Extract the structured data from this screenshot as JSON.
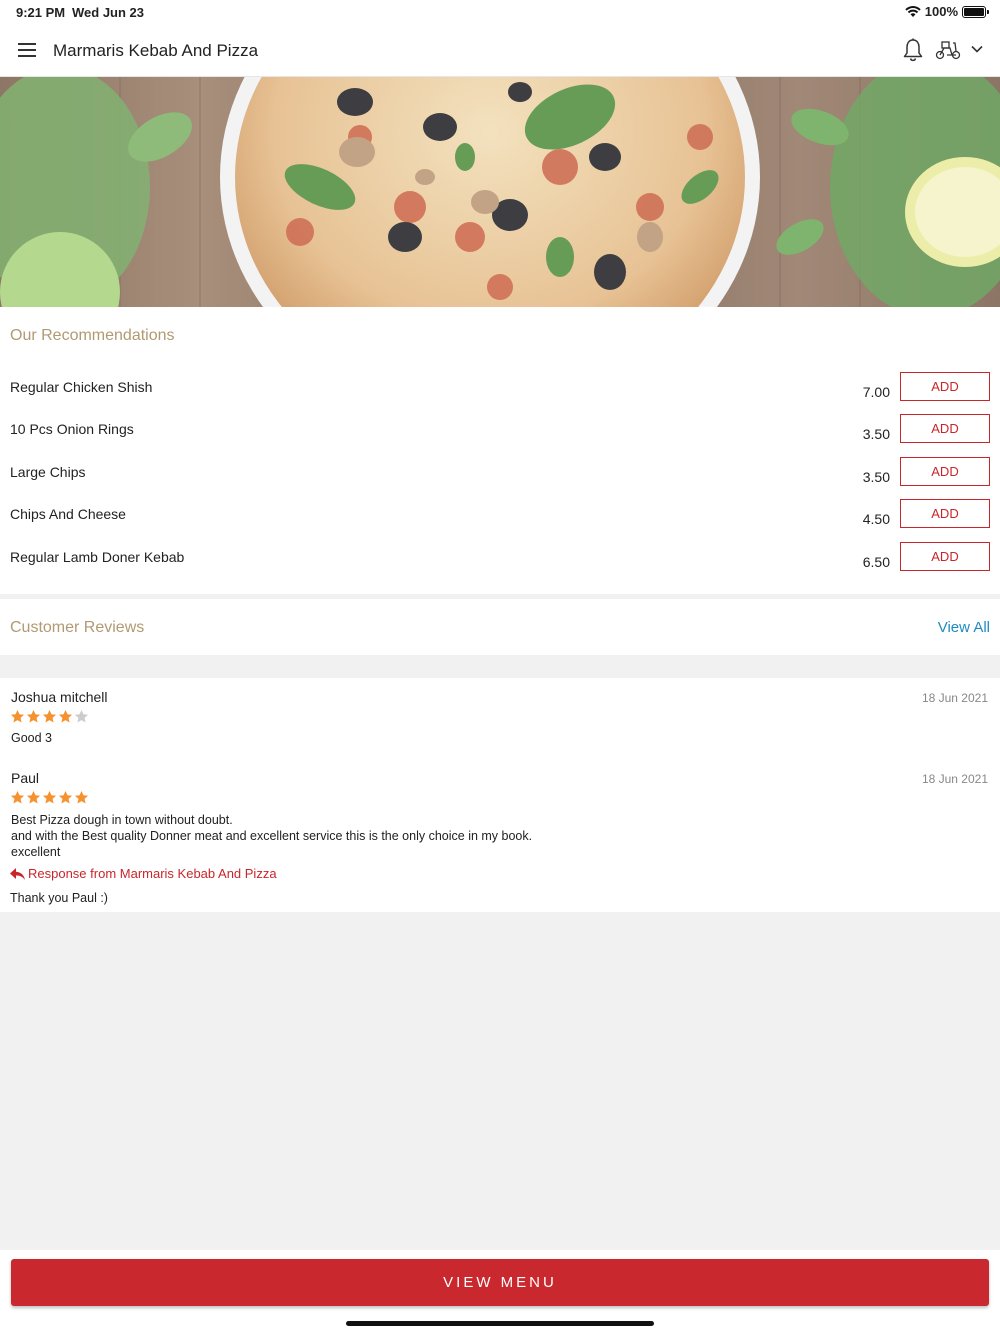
{
  "status_bar": {
    "time": "9:21 PM",
    "date": "Wed Jun 23",
    "battery": "100%"
  },
  "header": {
    "title": "Marmaris Kebab And Pizza"
  },
  "icons": {
    "menu": "hamburger-icon",
    "notifications": "bell-icon",
    "delivery": "scooter-icon",
    "dropdown": "chevron-down-icon"
  },
  "recommendations": {
    "title": "Our Recommendations",
    "items": [
      {
        "name": "Regular Chicken Shish",
        "price": "7.00",
        "action": "ADD"
      },
      {
        "name": "10 Pcs Onion Rings",
        "price": "3.50",
        "action": "ADD"
      },
      {
        "name": "Large Chips",
        "price": "3.50",
        "action": "ADD"
      },
      {
        "name": "Chips And Cheese",
        "price": "4.50",
        "action": "ADD"
      },
      {
        "name": "Regular Lamb Doner Kebab",
        "price": "6.50",
        "action": "ADD"
      }
    ]
  },
  "reviews": {
    "title": "Customer Reviews",
    "view_all": "View All",
    "items": [
      {
        "name": "Joshua mitchell",
        "date": "18 Jun 2021",
        "rating": 4,
        "text": "Good 3"
      },
      {
        "name": "Paul",
        "date": "18 Jun 2021",
        "rating": 5,
        "text_lines": [
          "Best Pizza dough in town without doubt.",
          "and with the Best quality Donner meat and excellent service this is the only choice in my book.",
          "excellent"
        ],
        "response_label": "Response from Marmaris Kebab And Pizza",
        "response_text": "Thank you Paul :)"
      }
    ]
  },
  "footer": {
    "view_menu": "VIEW MENU"
  },
  "colors": {
    "accent": "#c9292e",
    "section_title": "#b19a72",
    "link": "#1e8bc3",
    "star": "#f5922f",
    "star_empty": "#cccccc"
  }
}
